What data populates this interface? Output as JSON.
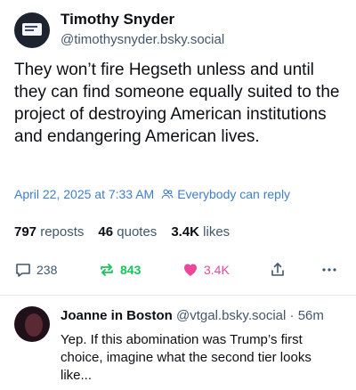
{
  "post": {
    "author_name": "Timothy Snyder",
    "author_handle": "@timothysnyder.bsky.social",
    "text": "They won’t fire Hegseth unless and until they can find someone equally suited to the project of destroying American institutions and endangering American lives.",
    "timestamp": "April 22, 2025 at 7:33 AM",
    "audience": "Everybody can reply",
    "stats": {
      "reposts_count": "797",
      "reposts_label": "reposts",
      "quotes_count": "46",
      "quotes_label": "quotes",
      "likes_count": "3.4K",
      "likes_label": "likes"
    },
    "actions": {
      "reply_count": "238",
      "repost_count": "843",
      "like_count": "3.4K"
    }
  },
  "reply": {
    "author_name": "Joanne in Boston",
    "author_handle": "@vtgal.bsky.social",
    "separator": "·",
    "time": "56m",
    "text": "Yep.  If this abomination was Trump’s first choice, imagine what the second tier looks like..."
  },
  "colors": {
    "link": "#3f7ec9",
    "repost_active": "#13c65a",
    "like_active": "#ec4899",
    "muted": "#42576c"
  }
}
